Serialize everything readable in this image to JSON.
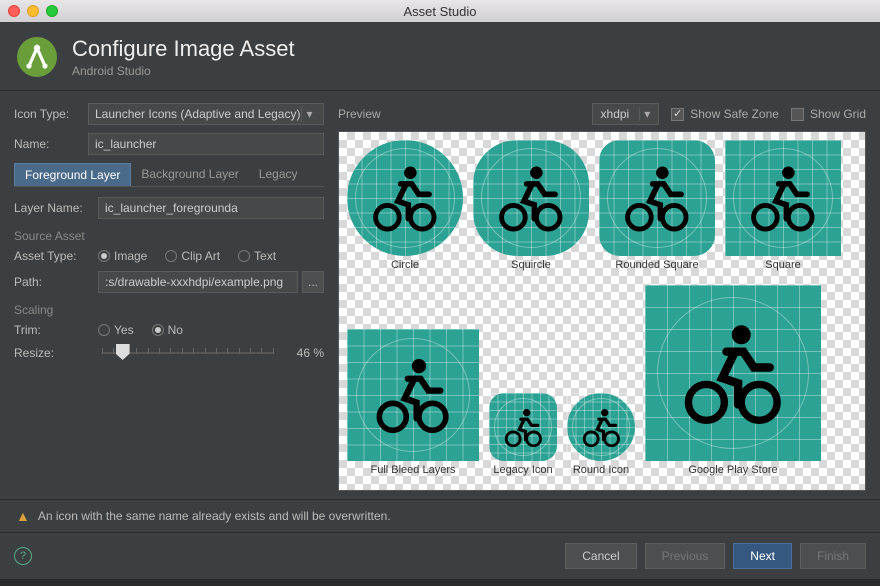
{
  "window": {
    "title": "Asset Studio"
  },
  "header": {
    "title": "Configure Image Asset",
    "subtitle": "Android Studio",
    "logo": "android-studio-logo"
  },
  "left": {
    "icon_type_label": "Icon Type:",
    "icon_type_value": "Launcher Icons (Adaptive and Legacy)",
    "name_label": "Name:",
    "name_value": "ic_launcher",
    "tabs": {
      "foreground": "Foreground Layer",
      "background": "Background Layer",
      "legacy": "Legacy"
    },
    "layer_name_label": "Layer Name:",
    "layer_name_value": "ic_launcher_foregrounda",
    "source_asset_header": "Source Asset",
    "asset_type_label": "Asset Type:",
    "asset_type_options": {
      "image": "Image",
      "clipart": "Clip Art",
      "text": "Text"
    },
    "asset_type_selected": "image",
    "path_label": "Path:",
    "path_value": ":s/drawable-xxxhdpi/example.png",
    "path_browse": "...",
    "scaling_header": "Scaling",
    "trim_label": "Trim:",
    "trim_options": {
      "yes": "Yes",
      "no": "No"
    },
    "trim_selected": "no",
    "resize_label": "Resize:",
    "resize_value": "46 %",
    "resize_percent": 46
  },
  "preview": {
    "label": "Preview",
    "density_value": "xhdpi",
    "show_safe_zone_label": "Show Safe Zone",
    "show_safe_zone": true,
    "show_grid_label": "Show Grid",
    "show_grid": false,
    "row1": [
      {
        "key": "circle",
        "label": "Circle",
        "shape": "s-circle",
        "size": 116
      },
      {
        "key": "squircle",
        "label": "Squircle",
        "shape": "s-squircle",
        "size": 116
      },
      {
        "key": "rounded_square",
        "label": "Rounded Square",
        "shape": "s-rsq",
        "size": 116
      },
      {
        "key": "square",
        "label": "Square",
        "shape": "s-sq",
        "size": 116
      }
    ],
    "row2": [
      {
        "key": "full_bleed",
        "label": "Full Bleed Layers",
        "shape": "s-sq",
        "size": 132,
        "overlay": true
      },
      {
        "key": "legacy_icon",
        "label": "Legacy Icon",
        "shape": "s-rounded",
        "size": 68
      },
      {
        "key": "round_icon",
        "label": "Round Icon",
        "shape": "s-round",
        "size": 68
      },
      {
        "key": "play_store",
        "label": "Google Play Store",
        "shape": "s-sq",
        "size": 176,
        "overlay": true
      }
    ]
  },
  "warning": "An icon with the same name already exists and will be overwritten.",
  "footer": {
    "cancel": "Cancel",
    "previous": "Previous",
    "next": "Next",
    "finish": "Finish"
  },
  "colors": {
    "accent": "#2ba293"
  }
}
